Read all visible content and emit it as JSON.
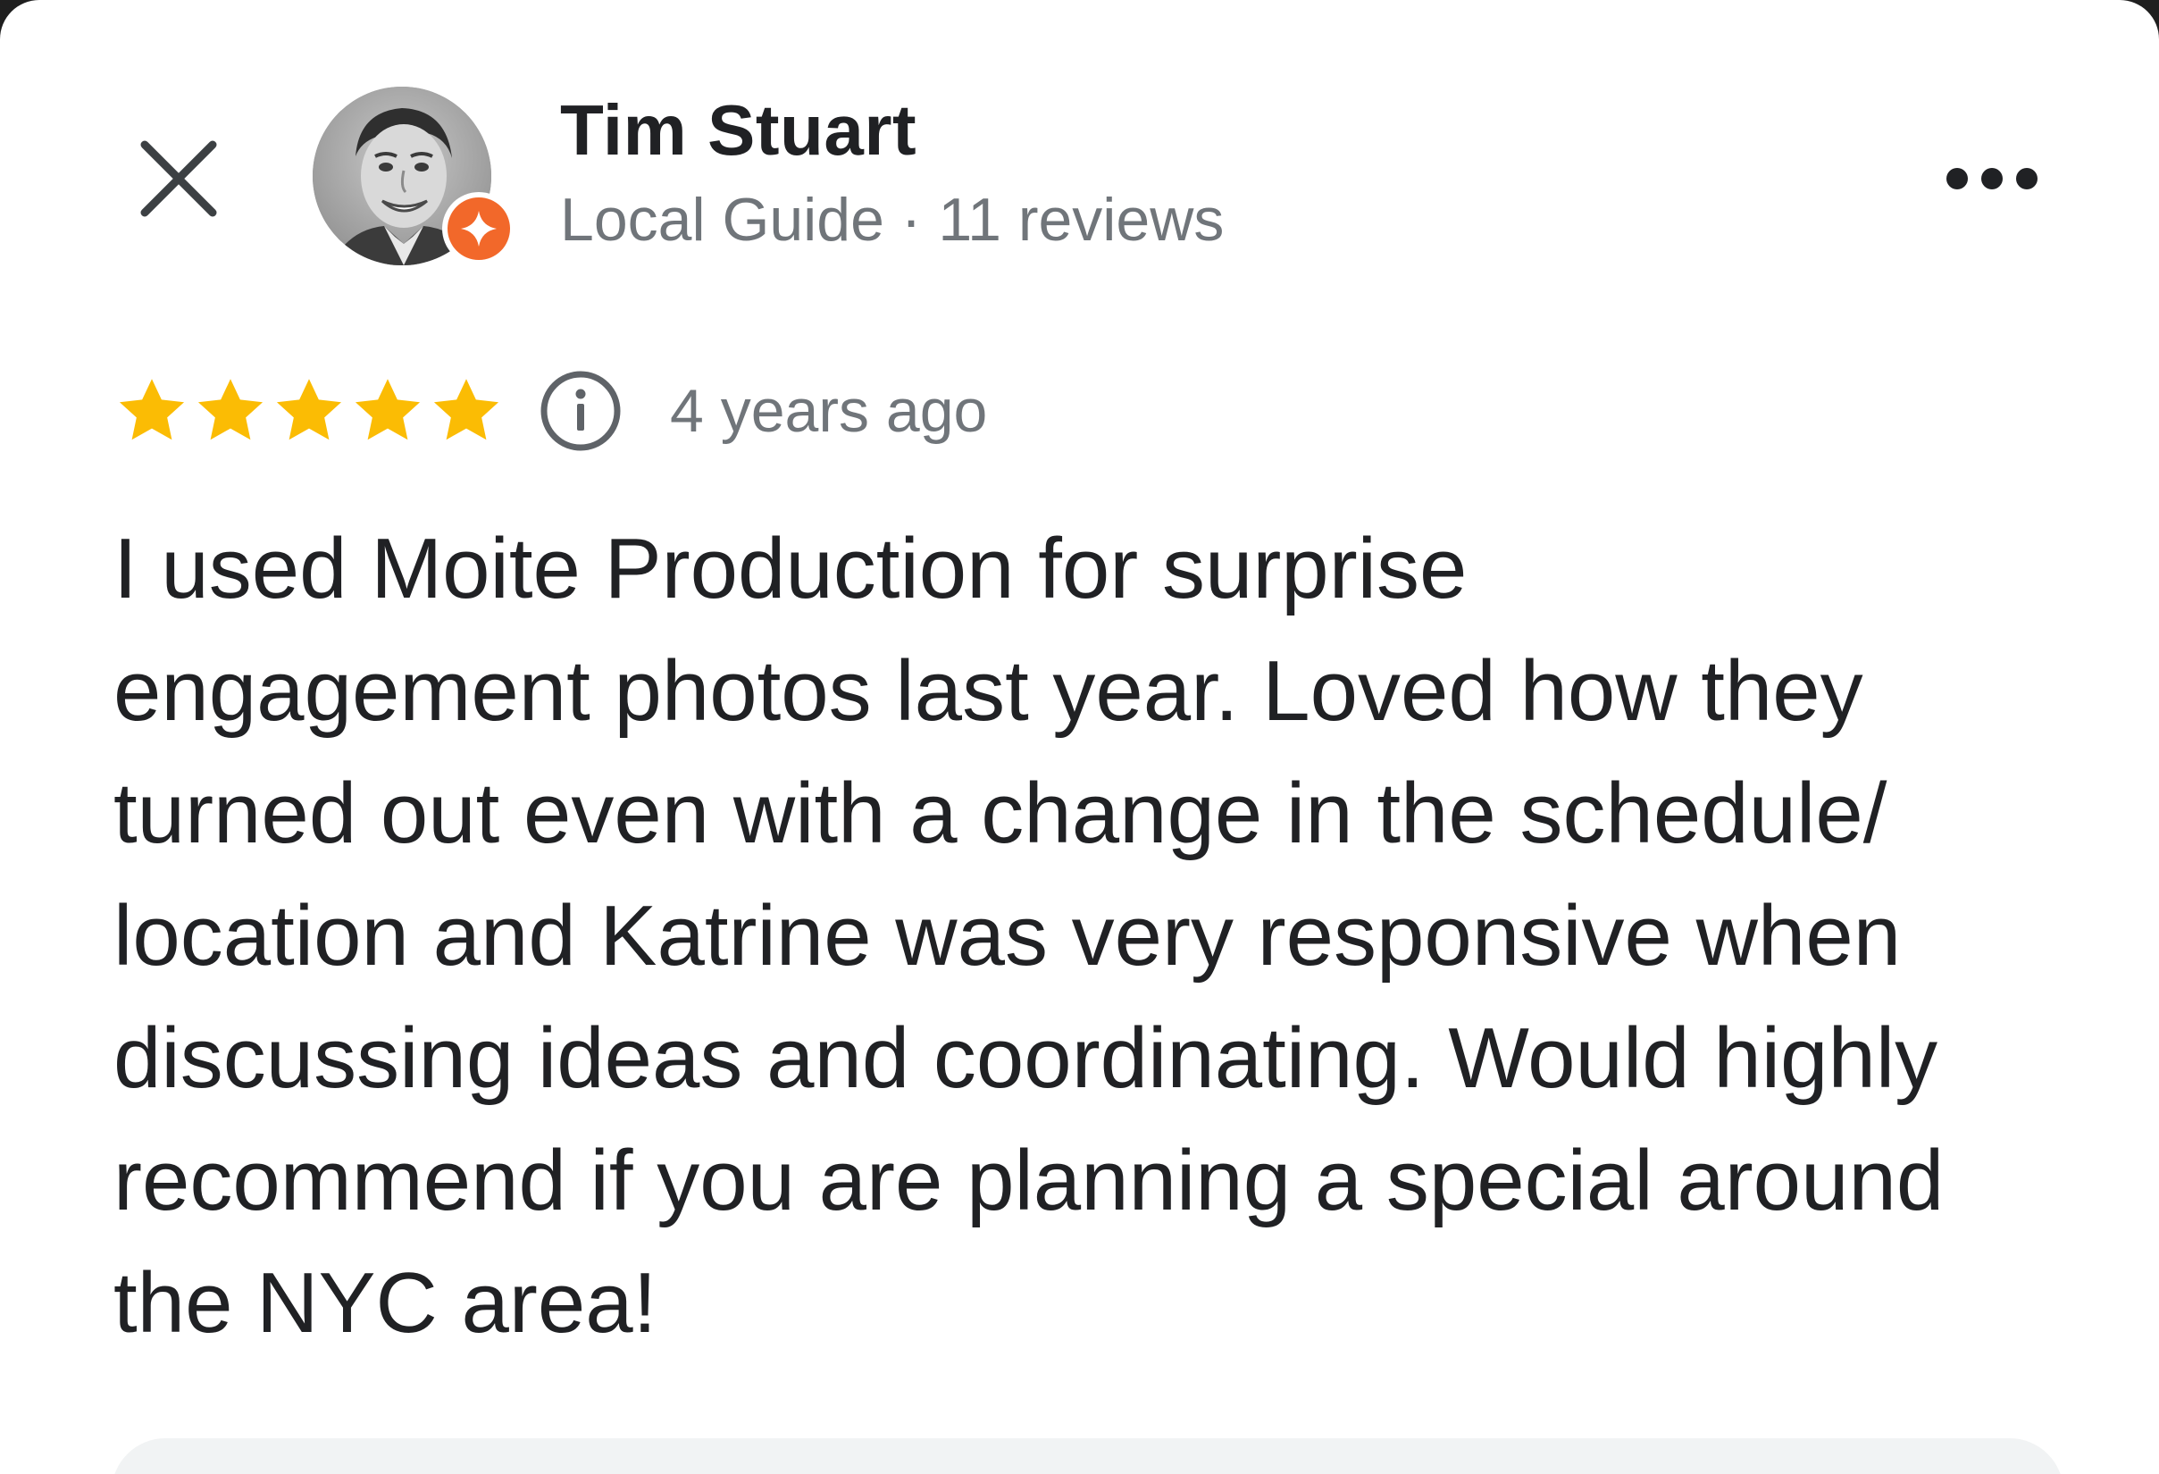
{
  "reviewer": {
    "name": "Tim Stuart",
    "meta": "Local Guide · 11 reviews",
    "avatar_icon": "person-avatar-icon",
    "badge_icon": "local-guide-badge-icon",
    "badge_color": "#f2682a"
  },
  "actions": {
    "close_icon": "close-icon",
    "more_icon": "more-options-icon"
  },
  "rating": {
    "stars": 5,
    "max_stars": 5,
    "star_color": "#fbbc04",
    "info_icon": "info-icon",
    "time_ago": "4 years ago"
  },
  "review": {
    "text": "I used Moite Production for surprise\nengagement photos last year. Loved how they\nturned out even with a change in the schedule/\nlocation and Katrine was very responsive when\ndiscussing ideas and coordinating. Would highly\nrecommend if you are planning a special around\nthe NYC area!"
  },
  "colors": {
    "text_primary": "#202124",
    "text_secondary": "#70757a",
    "background": "#ffffff"
  }
}
